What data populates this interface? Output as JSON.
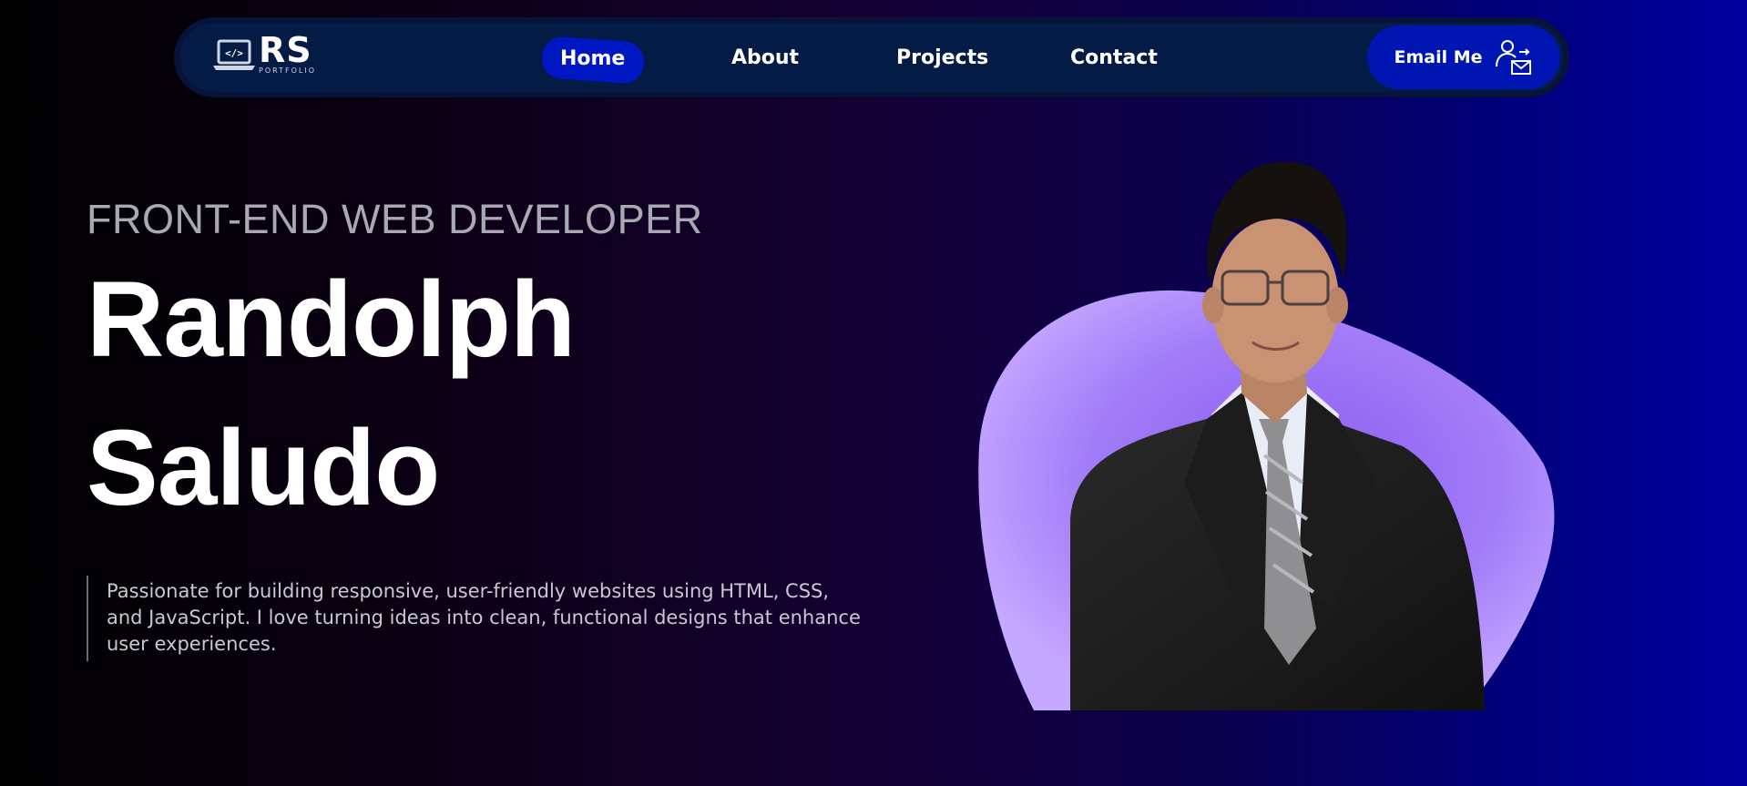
{
  "brand": {
    "logo_text": "RS",
    "logo_subtext": "PORTFOLIO",
    "logo_icon": "laptop-code-icon"
  },
  "nav": {
    "items": [
      {
        "label": "Home",
        "active": true
      },
      {
        "label": "About",
        "active": false
      },
      {
        "label": "Projects",
        "active": false
      },
      {
        "label": "Contact",
        "active": false
      }
    ],
    "cta_label": "Email Me",
    "cta_icon": "user-mail-icon"
  },
  "hero": {
    "subtitle": "FRONT-END WEB DEVELOPER",
    "first_name": "Randolph",
    "last_name": "Saludo",
    "intro": "Passionate for building responsive, user-friendly websites using HTML, CSS, and JavaScript. I love turning ideas into clean, functional designs that enhance user experiences."
  },
  "colors": {
    "nav_bg": "#031b45",
    "accent_blue": "#0017c4",
    "blob_purple": "#a27cf8"
  }
}
